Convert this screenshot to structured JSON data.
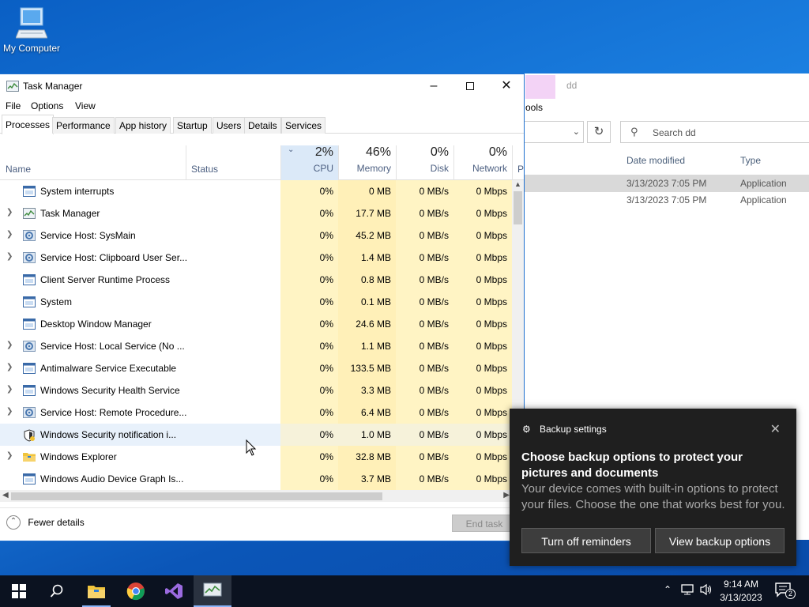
{
  "desktop": {
    "icon_label": "My Computer"
  },
  "explorer": {
    "title": "dd",
    "ribbon_fragment": "ools",
    "search_placeholder": "Search dd",
    "columns": [
      "Date modified",
      "Type"
    ],
    "rows": [
      {
        "date": "3/13/2023 7:05 PM",
        "type": "Application"
      },
      {
        "date": "3/13/2023 7:05 PM",
        "type": "Application"
      }
    ]
  },
  "taskmgr": {
    "title": "Task Manager",
    "menu": [
      "File",
      "Options",
      "View"
    ],
    "tabs": [
      "Processes",
      "Performance",
      "App history",
      "Startup",
      "Users",
      "Details",
      "Services"
    ],
    "active_tab": "Processes",
    "columns": {
      "name": "Name",
      "status": "Status",
      "cpu": {
        "pct": "2%",
        "label": "CPU"
      },
      "memory": {
        "pct": "46%",
        "label": "Memory"
      },
      "disk": {
        "pct": "0%",
        "label": "Disk"
      },
      "network": {
        "pct": "0%",
        "label": "Network"
      },
      "power_fragment": "P"
    },
    "processes": [
      {
        "name": "System interrupts",
        "cpu": "0%",
        "mem": "0 MB",
        "disk": "0 MB/s",
        "net": "0 Mbps",
        "expand": false,
        "icon": "system-window-icon"
      },
      {
        "name": "Task Manager",
        "cpu": "0%",
        "mem": "17.7 MB",
        "disk": "0 MB/s",
        "net": "0 Mbps",
        "expand": true,
        "icon": "task-manager-icon"
      },
      {
        "name": "Service Host: SysMain",
        "cpu": "0%",
        "mem": "45.2 MB",
        "disk": "0 MB/s",
        "net": "0 Mbps",
        "expand": true,
        "icon": "service-gear-icon"
      },
      {
        "name": "Service Host: Clipboard User Ser...",
        "cpu": "0%",
        "mem": "1.4 MB",
        "disk": "0 MB/s",
        "net": "0 Mbps",
        "expand": true,
        "icon": "service-gear-icon"
      },
      {
        "name": "Client Server Runtime Process",
        "cpu": "0%",
        "mem": "0.8 MB",
        "disk": "0 MB/s",
        "net": "0 Mbps",
        "expand": false,
        "icon": "system-window-icon"
      },
      {
        "name": "System",
        "cpu": "0%",
        "mem": "0.1 MB",
        "disk": "0 MB/s",
        "net": "0 Mbps",
        "expand": false,
        "icon": "system-window-icon"
      },
      {
        "name": "Desktop Window Manager",
        "cpu": "0%",
        "mem": "24.6 MB",
        "disk": "0 MB/s",
        "net": "0 Mbps",
        "expand": false,
        "icon": "system-window-icon"
      },
      {
        "name": "Service Host: Local Service (No ...",
        "cpu": "0%",
        "mem": "1.1 MB",
        "disk": "0 MB/s",
        "net": "0 Mbps",
        "expand": true,
        "icon": "service-gear-icon"
      },
      {
        "name": "Antimalware Service Executable",
        "cpu": "0%",
        "mem": "133.5 MB",
        "disk": "0 MB/s",
        "net": "0 Mbps",
        "expand": true,
        "icon": "system-window-icon"
      },
      {
        "name": "Windows Security Health Service",
        "cpu": "0%",
        "mem": "3.3 MB",
        "disk": "0 MB/s",
        "net": "0 Mbps",
        "expand": true,
        "icon": "system-window-icon"
      },
      {
        "name": "Service Host: Remote Procedure...",
        "cpu": "0%",
        "mem": "6.4 MB",
        "disk": "0 MB/s",
        "net": "0 Mbps",
        "expand": true,
        "icon": "service-gear-icon"
      },
      {
        "name": "Windows Security notification i...",
        "cpu": "0%",
        "mem": "1.0 MB",
        "disk": "0 MB/s",
        "net": "0 Mbps",
        "expand": false,
        "icon": "shield-icon",
        "highlight": true
      },
      {
        "name": "Windows Explorer",
        "cpu": "0%",
        "mem": "32.8 MB",
        "disk": "0 MB/s",
        "net": "0 Mbps",
        "expand": true,
        "icon": "folder-icon"
      },
      {
        "name": "Windows Audio Device Graph Is...",
        "cpu": "0%",
        "mem": "3.7 MB",
        "disk": "0 MB/s",
        "net": "0 Mbps",
        "expand": false,
        "icon": "system-window-icon"
      }
    ],
    "fewer_details": "Fewer details",
    "end_task": "End task"
  },
  "toast": {
    "app": "Backup settings",
    "headline": "Choose backup options to protect your pictures and documents",
    "body": "Your device comes with built-in options to protect your files. Choose the one that works best for you.",
    "button_left": "Turn off reminders",
    "button_right": "View backup options"
  },
  "taskbar": {
    "time": "9:14 AM",
    "date": "3/13/2023",
    "notification_count": "2"
  }
}
